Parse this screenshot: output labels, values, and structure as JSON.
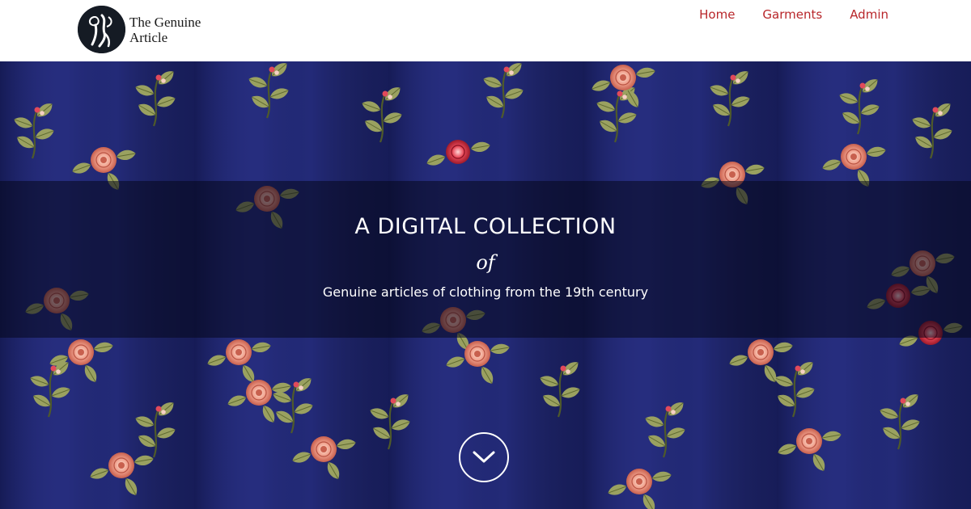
{
  "brand": {
    "name_line1": "The Genuine",
    "name_line2": "Article"
  },
  "nav": {
    "items": [
      {
        "label": "Home"
      },
      {
        "label": "Garments"
      },
      {
        "label": "Admin"
      }
    ],
    "color": "#b8262a"
  },
  "hero": {
    "headline": "A DIGITAL COLLECTION",
    "connector": "of",
    "subtitle": "Genuine articles of clothing from the 19th century",
    "background_image": "navy blue silk fabric with embroidered pink and red roses and green leaves",
    "scroll_icon": "chevron-down-icon"
  },
  "colors": {
    "fabric": "#232a78",
    "logo_circle": "#151b24",
    "nav_link": "#b8262a"
  }
}
